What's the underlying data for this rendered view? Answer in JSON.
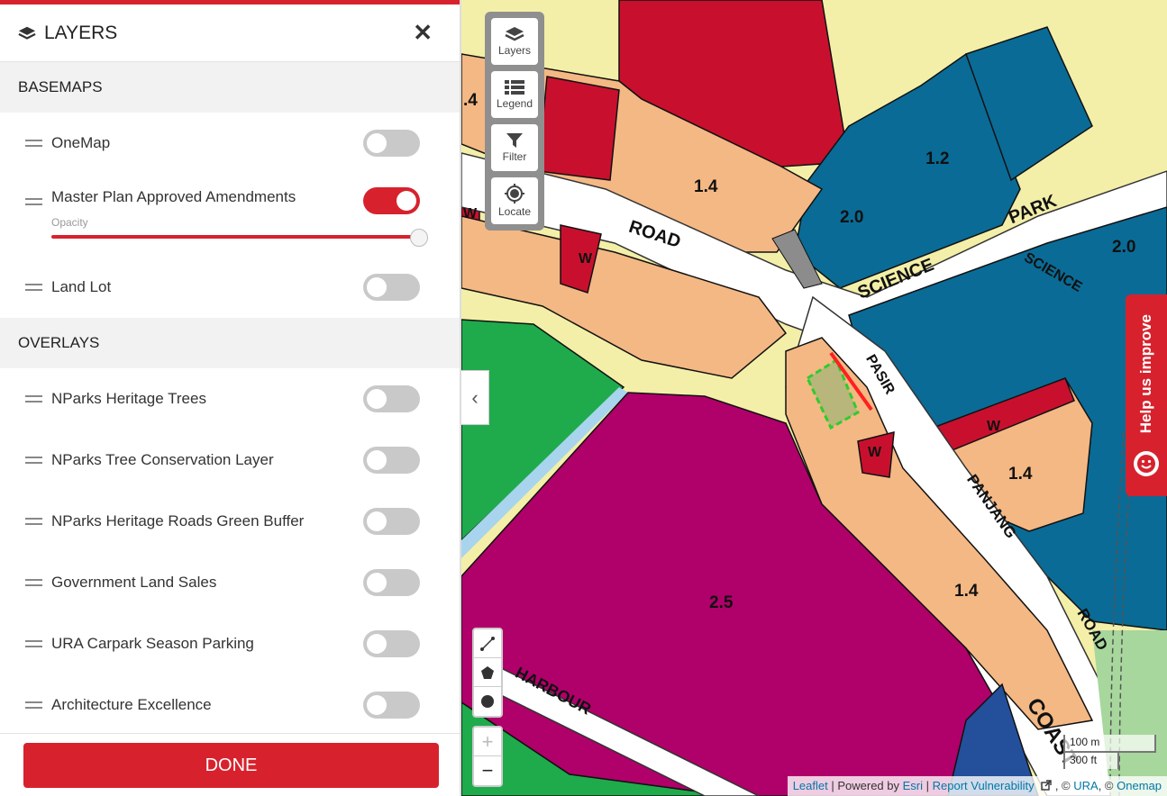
{
  "panel": {
    "title": "LAYERS",
    "basemaps_heading": "BASEMAPS",
    "overlays_heading": "OVERLAYS",
    "basemaps": [
      {
        "label": "OneMap",
        "on": false
      },
      {
        "label": "Master Plan Approved Amendments",
        "on": true,
        "opacity_label": "Opacity",
        "opacity": 1.0
      },
      {
        "label": "Land Lot",
        "on": false
      }
    ],
    "overlays": [
      {
        "label": "NParks Heritage Trees",
        "on": false
      },
      {
        "label": "NParks Tree Conservation Layer",
        "on": false
      },
      {
        "label": "NParks Heritage Roads Green Buffer",
        "on": false
      },
      {
        "label": "Government Land Sales",
        "on": false
      },
      {
        "label": "URA Carpark Season Parking",
        "on": false
      },
      {
        "label": "Architecture Excellence",
        "on": false
      }
    ],
    "done_label": "DONE"
  },
  "map_controls": {
    "layers": "Layers",
    "legend": "Legend",
    "filter": "Filter",
    "locate": "Locate",
    "zoom_in": "+",
    "zoom_out": "−",
    "collapse": "‹"
  },
  "help": {
    "label": "Help us improve"
  },
  "scale": {
    "metric": "100 m",
    "imperial": "300 ft"
  },
  "attribution": {
    "leaflet": "Leaflet",
    "powered_by": " | Powered by ",
    "esri": "Esri",
    "sep1": " | ",
    "report": "Report Vulnerability",
    "sep2": " , © ",
    "ura": "URA",
    "sep3": ", © ",
    "onemap": "Onemap"
  },
  "map_labels": {
    "road": "ROAD",
    "science": "SCIENCE",
    "park": "PARK",
    "science2": "SCIENCE",
    "pasir": "PASIR",
    "panjang": "PANJANG",
    "road2": "ROAD",
    "coast": "COAST",
    "harbour": "HARBOUR",
    "pr_14a": "1.4",
    "pr_14b": "1.4",
    "pr_14c": "1.4",
    "pr_14d": ".4",
    "pr_12": "1.2",
    "pr_20a": "2.0",
    "pr_20b": "2.0",
    "pr_25": "2.5",
    "w1": "W",
    "w2": "W",
    "w3": "W",
    "w4": "W"
  },
  "colors": {
    "accent": "#d7222d",
    "residential": "#f4b884",
    "commercial": "#c8102e",
    "business": "#0a6b96",
    "park": "#1fab4c",
    "special": "#b0006a",
    "road": "#ffffff",
    "yellow_bg": "#f3efa8"
  }
}
